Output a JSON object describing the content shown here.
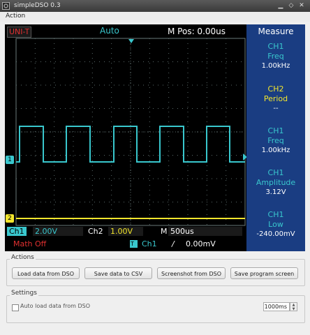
{
  "window": {
    "title": "simpleDSO 0.3"
  },
  "menu": {
    "action_label": "Action"
  },
  "scope": {
    "trigger_mode_label": "UNI-T",
    "acquire_mode": "Auto",
    "main_position": "M Pos: 0.00us",
    "measure_header": "Measure",
    "measurements": [
      {
        "ch": "CH1",
        "name": "Freq",
        "value": "1.00kHz",
        "color": "#39c7cd"
      },
      {
        "ch": "CH2",
        "name": "Period",
        "value": "--",
        "color": "#f2e52c"
      },
      {
        "ch": "CH1",
        "name": "Freq",
        "value": "1.00kHz",
        "color": "#39c7cd"
      },
      {
        "ch": "CH1",
        "name": "Amplitude",
        "value": "3.12V",
        "color": "#39c7cd"
      },
      {
        "ch": "CH1",
        "name": "Low",
        "value": "-240.00mV",
        "color": "#39c7cd"
      }
    ],
    "ch1_marker": "1",
    "ch2_marker": "2",
    "footer": {
      "ch1_label": "Ch1",
      "ch1_scale": "2.00V",
      "ch2_label": "Ch2",
      "ch2_scale": "1.00V",
      "time_label": "M",
      "time_scale": "500us",
      "math_label": "Math Off",
      "trigger_marker": "T",
      "trigger_source": "Ch1",
      "trigger_edge": "/",
      "trigger_level": "0.00mV"
    },
    "colors": {
      "ch1": "#39c7cd",
      "ch2": "#f2e52c",
      "grid": "#5a6a6a",
      "math": "#e03030",
      "trigger_label": "#e03030"
    }
  },
  "actions": {
    "group_title": "Actions",
    "load_button": "Load data from DSO",
    "save_csv_button": "Save data to CSV",
    "screenshot_button": "Screenshot from DSO",
    "save_screen_button": "Save program screen"
  },
  "settings": {
    "group_title": "Settings",
    "auto_load_label": "Auto load data from DSO",
    "auto_load_checked": false,
    "interval_value": "1000ms"
  }
}
